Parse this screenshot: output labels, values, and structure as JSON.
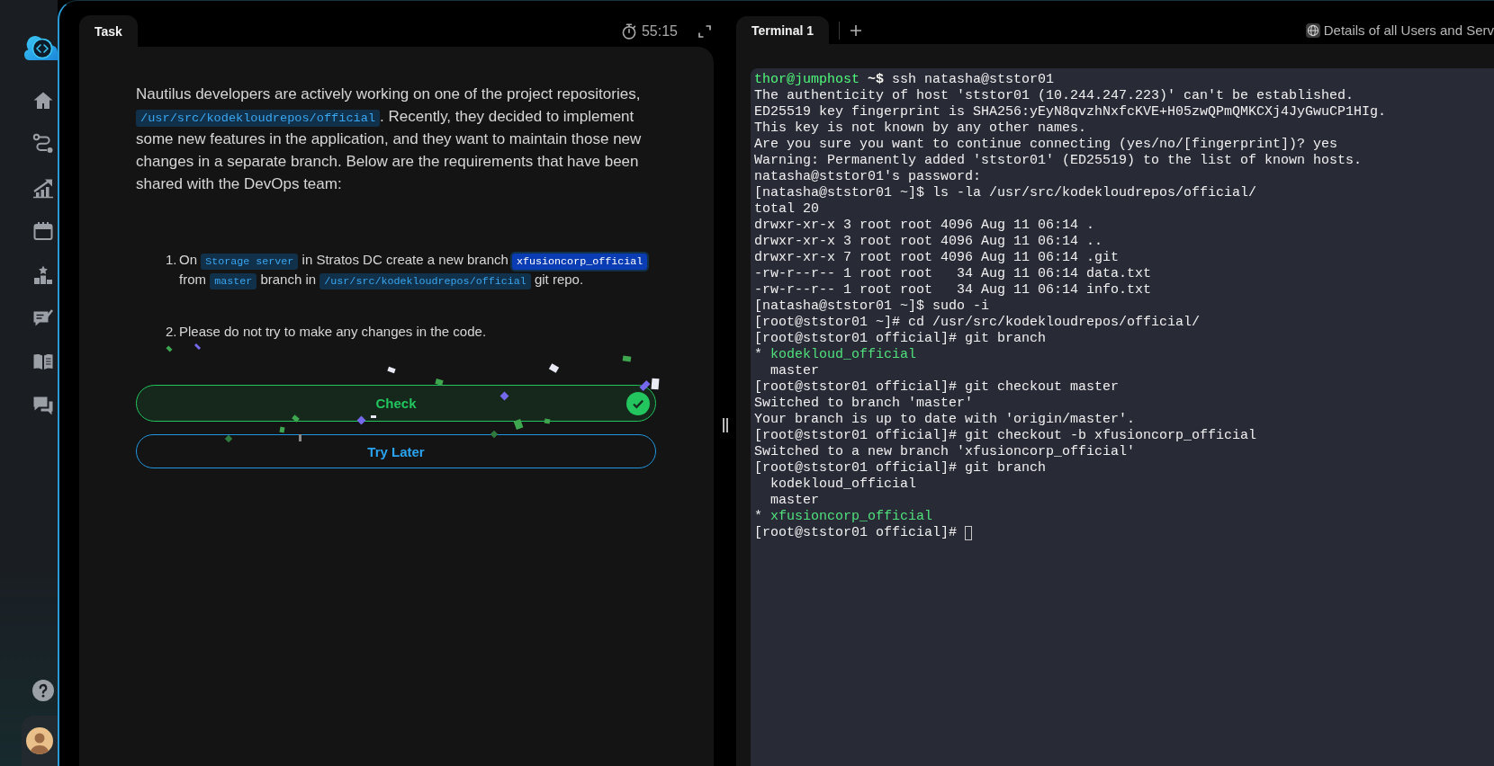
{
  "task_panel": {
    "tabs": [
      {
        "label": "Task",
        "selected": true
      }
    ],
    "timer": "55:15",
    "description": [
      {
        "kind": "text",
        "text": "Nautilus developers are actively working on one of the project repositories, "
      },
      {
        "kind": "code",
        "text": "/usr/src/kodekloudrepos/official"
      },
      {
        "kind": "text",
        "text": ". Recently, they decided to implement some new features in the application, and they want to maintain those new changes in a separate branch. Below are the requirements that have been shared with the DevOps team:"
      }
    ],
    "requirements": [
      {
        "number": "1.",
        "segments": [
          {
            "kind": "text",
            "text": "On "
          },
          {
            "kind": "code",
            "text": "Storage server"
          },
          {
            "kind": "text",
            "text": " in Stratos DC create a new branch "
          },
          {
            "kind": "code-selected",
            "text": "xfusioncorp_official"
          },
          {
            "kind": "text",
            "text": " from "
          },
          {
            "kind": "code",
            "text": "master"
          },
          {
            "kind": "text",
            "text": " branch in "
          },
          {
            "kind": "code",
            "text": "/usr/src/kodekloudrepos/official"
          },
          {
            "kind": "text",
            "text": " git repo."
          }
        ]
      },
      {
        "number": "2.",
        "segments": [
          {
            "kind": "text",
            "text": "Please do not try to make any changes in the code."
          }
        ]
      }
    ],
    "check_button": {
      "label": "Check",
      "passed": true
    },
    "try_later_button": {
      "label": "Try Later"
    }
  },
  "terminal_panel": {
    "tabs": [
      {
        "label": "Terminal 1",
        "selected": true
      }
    ],
    "details_link": "Details of all Users and Serv",
    "cursor": true,
    "lines": [
      {
        "segments": [
          {
            "kind": "user",
            "text": "thor@jumphost"
          },
          {
            "kind": "prompt",
            "text": " ~$"
          },
          {
            "kind": "plain",
            "text": " ssh natasha@ststor01"
          }
        ]
      },
      {
        "segments": [
          {
            "kind": "plain",
            "text": "The authenticity of host 'ststor01 (10.244.247.223)' can't be established."
          }
        ]
      },
      {
        "segments": [
          {
            "kind": "plain",
            "text": "ED25519 key fingerprint is SHA256:yEyN8qvzhNxfcKVE+H05zwQPmQMKCXj4JyGwuCP1HIg."
          }
        ]
      },
      {
        "segments": [
          {
            "kind": "plain",
            "text": "This key is not known by any other names."
          }
        ]
      },
      {
        "segments": [
          {
            "kind": "plain",
            "text": "Are you sure you want to continue connecting (yes/no/[fingerprint])? yes"
          }
        ]
      },
      {
        "segments": [
          {
            "kind": "plain",
            "text": "Warning: Permanently added 'ststor01' (ED25519) to the list of known hosts."
          }
        ]
      },
      {
        "segments": [
          {
            "kind": "plain",
            "text": "natasha@ststor01's password:"
          }
        ]
      },
      {
        "segments": [
          {
            "kind": "plain",
            "text": "[natasha@ststor01 ~]$ ls -la /usr/src/kodekloudrepos/official/"
          }
        ]
      },
      {
        "segments": [
          {
            "kind": "plain",
            "text": "total 20"
          }
        ]
      },
      {
        "segments": [
          {
            "kind": "plain",
            "text": "drwxr-xr-x 3 root root 4096 Aug 11 06:14 ."
          }
        ]
      },
      {
        "segments": [
          {
            "kind": "plain",
            "text": "drwxr-xr-x 3 root root 4096 Aug 11 06:14 .."
          }
        ]
      },
      {
        "segments": [
          {
            "kind": "plain",
            "text": "drwxr-xr-x 7 root root 4096 Aug 11 06:14 .git"
          }
        ]
      },
      {
        "segments": [
          {
            "kind": "plain",
            "text": "-rw-r--r-- 1 root root   34 Aug 11 06:14 data.txt"
          }
        ]
      },
      {
        "segments": [
          {
            "kind": "plain",
            "text": "-rw-r--r-- 1 root root   34 Aug 11 06:14 info.txt"
          }
        ]
      },
      {
        "segments": [
          {
            "kind": "plain",
            "text": "[natasha@ststor01 ~]$ sudo -i"
          }
        ]
      },
      {
        "segments": [
          {
            "kind": "plain",
            "text": "[root@ststor01 ~]# cd /usr/src/kodekloudrepos/official/"
          }
        ]
      },
      {
        "segments": [
          {
            "kind": "plain",
            "text": "[root@ststor01 official]# git branch"
          }
        ]
      },
      {
        "segments": [
          {
            "kind": "plain",
            "text": "* "
          },
          {
            "kind": "branch",
            "text": "kodekloud_official"
          }
        ]
      },
      {
        "segments": [
          {
            "kind": "plain",
            "text": "  master"
          }
        ]
      },
      {
        "segments": [
          {
            "kind": "plain",
            "text": "[root@ststor01 official]# git checkout master"
          }
        ]
      },
      {
        "segments": [
          {
            "kind": "plain",
            "text": "Switched to branch 'master'"
          }
        ]
      },
      {
        "segments": [
          {
            "kind": "plain",
            "text": "Your branch is up to date with 'origin/master'."
          }
        ]
      },
      {
        "segments": [
          {
            "kind": "plain",
            "text": "[root@ststor01 official]# git checkout -b xfusioncorp_official"
          }
        ]
      },
      {
        "segments": [
          {
            "kind": "plain",
            "text": "Switched to a new branch 'xfusioncorp_official'"
          }
        ]
      },
      {
        "segments": [
          {
            "kind": "plain",
            "text": "[root@ststor01 official]# git branch"
          }
        ]
      },
      {
        "segments": [
          {
            "kind": "plain",
            "text": "  kodekloud_official"
          }
        ]
      },
      {
        "segments": [
          {
            "kind": "plain",
            "text": "  master"
          }
        ]
      },
      {
        "segments": [
          {
            "kind": "plain",
            "text": "* "
          },
          {
            "kind": "branch",
            "text": "xfusioncorp_official"
          }
        ]
      },
      {
        "segments": [
          {
            "kind": "plain",
            "text": "[root@ststor01 official]#"
          }
        ]
      }
    ]
  }
}
